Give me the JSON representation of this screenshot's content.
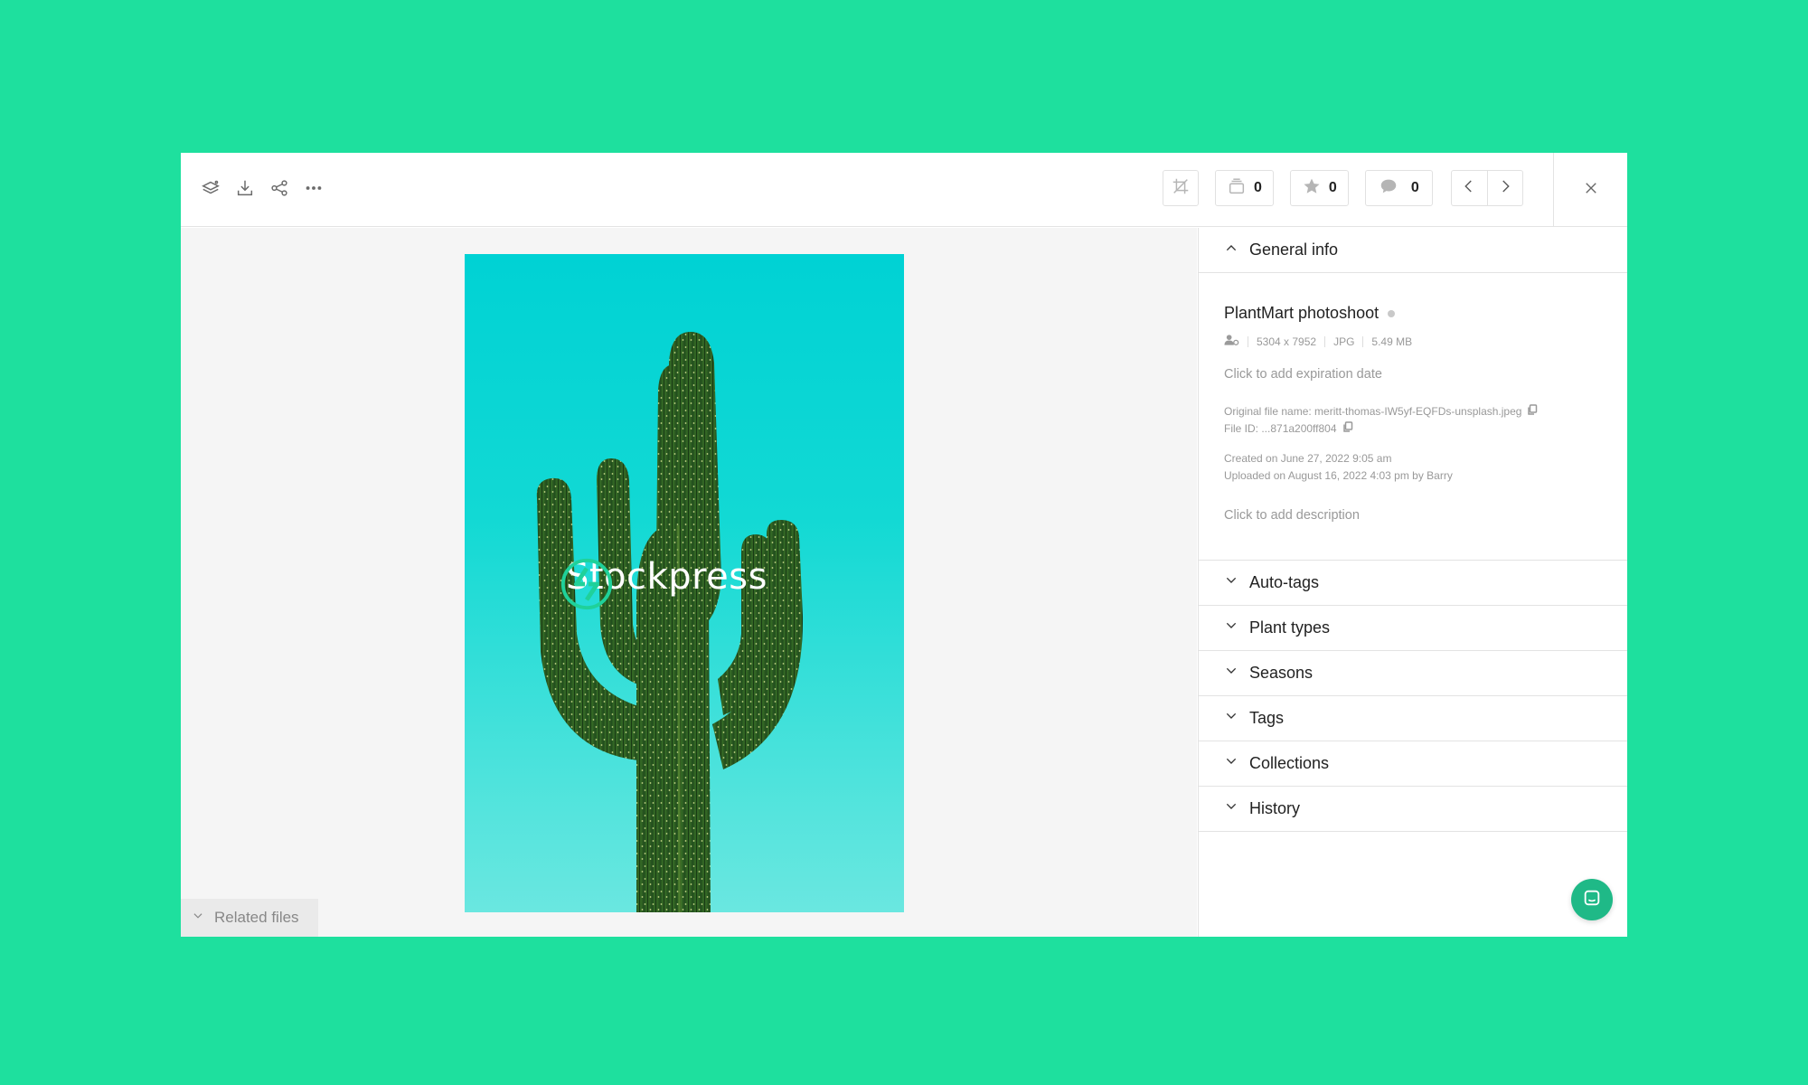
{
  "toolbar": {
    "left_icons": [
      "layers-icon",
      "download-icon",
      "share-icon",
      "more-icon"
    ],
    "crop_icon": "crop-icon",
    "stack_count": "0",
    "favorite_count": "0",
    "comment_count": "0"
  },
  "viewer": {
    "watermark_text": "Stockpress",
    "related_files_label": "Related files"
  },
  "panel": {
    "general_info_label": "General info",
    "asset": {
      "title": "PlantMart photoshoot",
      "dimensions": "5304 x 7952",
      "format": "JPG",
      "size": "5.49 MB",
      "expiration_prompt": "Click to add expiration date",
      "original_file_name": "Original file name: meritt-thomas-IW5yf-EQFDs-unsplash.jpeg",
      "file_id": "File ID: ...871a200ff804",
      "created": "Created on June 27, 2022 9:05 am",
      "uploaded": "Uploaded on August 16, 2022 4:03 pm by Barry",
      "description_prompt": "Click to add description"
    },
    "sections": [
      {
        "label": "Auto-tags"
      },
      {
        "label": "Plant types"
      },
      {
        "label": "Seasons"
      },
      {
        "label": "Tags"
      },
      {
        "label": "Collections"
      },
      {
        "label": "History"
      }
    ]
  },
  "colors": {
    "background": "#1ee09e",
    "accent": "#1fb987",
    "sky": "#00d2d4"
  }
}
